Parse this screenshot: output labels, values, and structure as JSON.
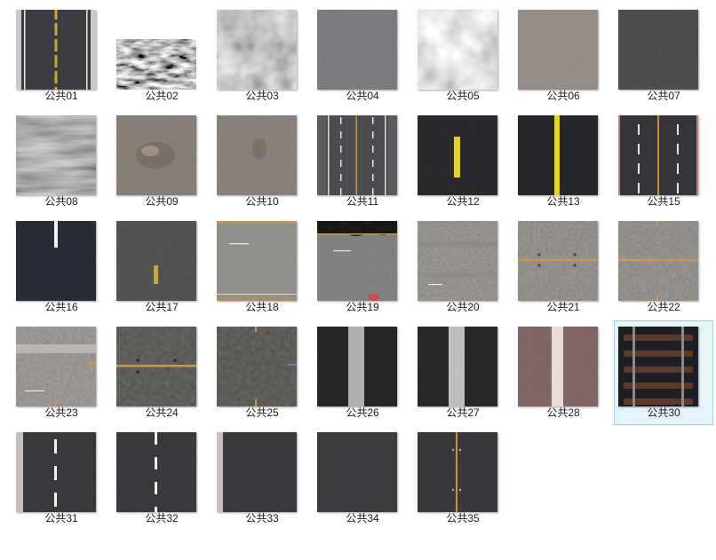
{
  "window": {
    "title": ""
  },
  "files": [
    {
      "name": "公共01",
      "texture": "road-center-yellow-dashed-light"
    },
    {
      "name": "公共02",
      "texture": "rocky-noise-small"
    },
    {
      "name": "公共03",
      "texture": "blurred-gray-cloud"
    },
    {
      "name": "公共04",
      "texture": "gray-asphalt-noise"
    },
    {
      "name": "公共05",
      "texture": "light-cloud-gray"
    },
    {
      "name": "公共06",
      "texture": "plain-brown-gray"
    },
    {
      "name": "公共07",
      "texture": "dark-gray-noise"
    },
    {
      "name": "公共08",
      "texture": "dark-gray-streak"
    },
    {
      "name": "公共09",
      "texture": "brown-gray-stain"
    },
    {
      "name": "公共10",
      "texture": "brown-gray-stain-small"
    },
    {
      "name": "公共11",
      "texture": "multi-lane-road"
    },
    {
      "name": "公共12",
      "texture": "dark-yellow-dash"
    },
    {
      "name": "公共13",
      "texture": "dark-yellow-solid"
    },
    {
      "name": "公共15",
      "texture": "four-lane-road"
    },
    {
      "name": "公共16",
      "texture": "dark-white-dash"
    },
    {
      "name": "公共17",
      "texture": "gray-small-yellow-dash"
    },
    {
      "name": "公共18",
      "texture": "light-gray-crossroad"
    },
    {
      "name": "公共19",
      "texture": "crossroad-top-trees"
    },
    {
      "name": "公共20",
      "texture": "concrete-lanes"
    },
    {
      "name": "公共21",
      "texture": "concrete-yellow-line"
    },
    {
      "name": "公共22",
      "texture": "concrete-junction"
    },
    {
      "name": "公共23",
      "texture": "concrete-lanes-light"
    },
    {
      "name": "公共24",
      "texture": "dark-concrete-yellow-line"
    },
    {
      "name": "公共25",
      "texture": "dark-concrete-junction"
    },
    {
      "name": "公共26",
      "texture": "dark-white-stripe-speckle"
    },
    {
      "name": "公共27",
      "texture": "dark-white-stripe-worn"
    },
    {
      "name": "公共28",
      "texture": "pink-white-stripe"
    },
    {
      "name": "公共30",
      "texture": "rail-track",
      "selected": true
    },
    {
      "name": "公共31",
      "texture": "road-white-dash-left-curb"
    },
    {
      "name": "公共32",
      "texture": "road-white-dash"
    },
    {
      "name": "公共33",
      "texture": "road-left-curb"
    },
    {
      "name": "公共34",
      "texture": "plain-dark-asphalt"
    },
    {
      "name": "公共35",
      "texture": "road-center-orange"
    }
  ],
  "colors": {
    "selection_bg": "#e5f3fb",
    "selection_border": "#99d1ef",
    "label": "#1a1a1a"
  }
}
